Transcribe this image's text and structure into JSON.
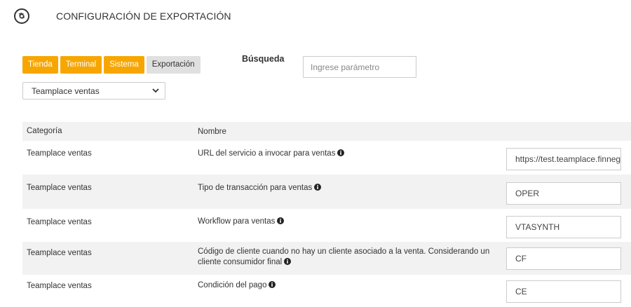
{
  "header": {
    "title": "CONFIGURACIÓN DE EXPORTACIÓN",
    "icon": "gear-icon"
  },
  "tabs": [
    {
      "label": "Tienda",
      "active": true
    },
    {
      "label": "Terminal",
      "active": true
    },
    {
      "label": "Sistema",
      "active": true
    },
    {
      "label": "Exportación",
      "active": false
    }
  ],
  "search": {
    "label": "Búsqueda",
    "placeholder": "Ingrese parámetro"
  },
  "selector": {
    "value": "Teamplace ventas"
  },
  "table": {
    "headers": {
      "category": "Categoría",
      "name": "Nombre"
    },
    "rows": [
      {
        "category": "Teamplace ventas",
        "name": "URL del servicio a invocar para ventas",
        "value": "https://test.teamplace.finneg"
      },
      {
        "category": "Teamplace ventas",
        "name": "Tipo de transacción para ventas",
        "value": "OPER"
      },
      {
        "category": "Teamplace ventas",
        "name": "Workflow para ventas",
        "value": "VTASYNTH"
      },
      {
        "category": "Teamplace ventas",
        "name": "Código de cliente cuando no hay un cliente asociado a la venta. Considerando un cliente consumidor final",
        "value": "CF"
      },
      {
        "category": "Teamplace ventas",
        "name": "Condición del pago",
        "value": "CE"
      }
    ]
  },
  "colors": {
    "accent": "#f7a600",
    "tab_inactive": "#e0e0e0",
    "row_alt": "#f2f2f2"
  }
}
